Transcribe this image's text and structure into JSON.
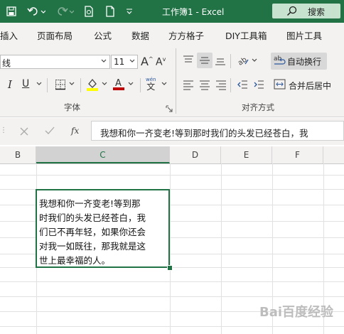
{
  "window": {
    "title": "工作簿1 - Excel",
    "search_label": "搜索",
    "colors": {
      "brand": "#217346",
      "search_bg": "#c7e3cf"
    }
  },
  "menu": {
    "tabs": [
      "插入",
      "页面布局",
      "公式",
      "数据",
      "方方格子",
      "DIY工具箱",
      "图片工具"
    ]
  },
  "ribbon": {
    "font_name": "线",
    "font_size": "11",
    "wrap_text_label": "自动换行",
    "merge_center_label": "合并后居中",
    "font_group_label": "字体",
    "align_group_label": "对齐方式",
    "wen_label": "wén",
    "wen_char": "文",
    "ab_label": "ab",
    "font_color": "#c00000",
    "fill_color": "#ffff00"
  },
  "formula_bar": {
    "fx_label": "fx",
    "content": "我想和你一齐变老!等到那时我们的头发已经苍白，我"
  },
  "sheet": {
    "columns": [
      "B",
      "C",
      "D",
      "E",
      "F"
    ],
    "cell_text": "我想和你一齐变老!等到那\n时我们的头发已经苍白，我\n们已不再年轻，如果你还会\n对我一如既往，那我就是这\n世上最幸福的人。"
  },
  "watermark": "Bai百度经验"
}
